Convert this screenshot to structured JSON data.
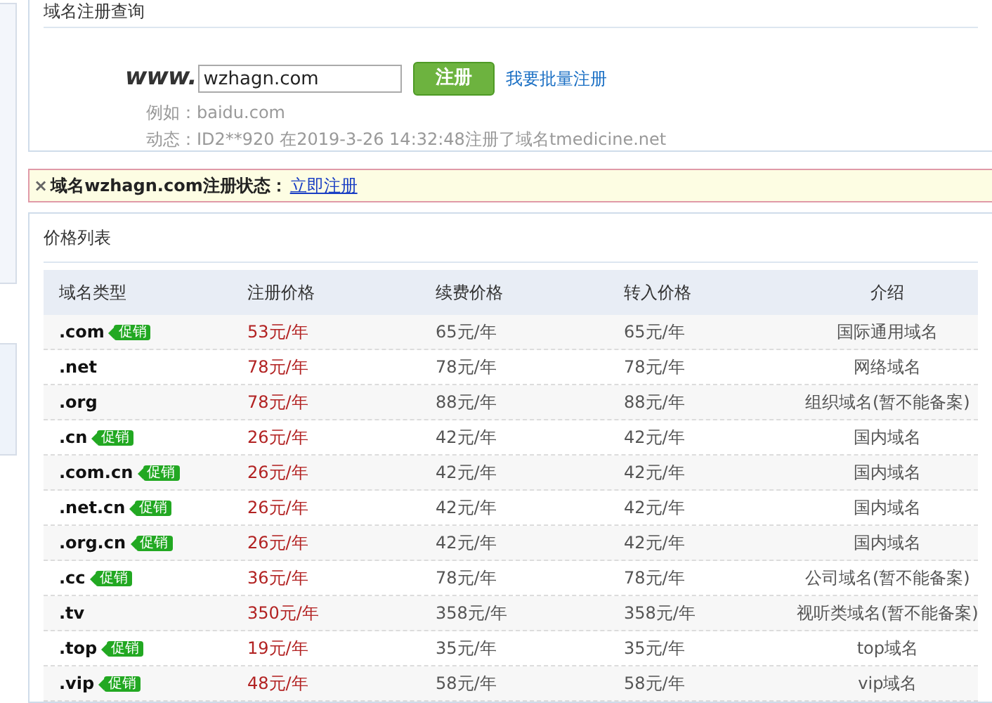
{
  "query_panel": {
    "title": "域名注册查询",
    "prefix": "www.",
    "domain_value": "wzhagn.com",
    "register_button": "注册",
    "bulk_link": "我要批量注册",
    "example": "例如：baidu.com",
    "activity": "动态：ID2**920 在2019-3-26 14:32:48注册了域名tmedicine.net"
  },
  "status_bar": {
    "close": "×",
    "message": "域名wzhagn.com注册状态：",
    "link": "立即注册"
  },
  "price_panel": {
    "title": "价格列表",
    "columns": [
      "域名类型",
      "注册价格",
      "续费价格",
      "转入价格",
      "介绍"
    ],
    "rows": [
      {
        "tld": ".com",
        "promo": true,
        "badge": "促销",
        "register": "53元/年",
        "renew": "65元/年",
        "transfer": "65元/年",
        "intro": "国际通用域名"
      },
      {
        "tld": ".net",
        "promo": false,
        "register": "78元/年",
        "renew": "78元/年",
        "transfer": "78元/年",
        "intro": "网络域名"
      },
      {
        "tld": ".org",
        "promo": false,
        "register": "78元/年",
        "renew": "88元/年",
        "transfer": "88元/年",
        "intro": "组织域名(暂不能备案)"
      },
      {
        "tld": ".cn",
        "promo": true,
        "badge": "促销",
        "register": "26元/年",
        "renew": "42元/年",
        "transfer": "42元/年",
        "intro": "国内域名"
      },
      {
        "tld": ".com.cn",
        "promo": true,
        "badge": "促销",
        "register": "26元/年",
        "renew": "42元/年",
        "transfer": "42元/年",
        "intro": "国内域名"
      },
      {
        "tld": ".net.cn",
        "promo": true,
        "badge": "促销",
        "register": "26元/年",
        "renew": "42元/年",
        "transfer": "42元/年",
        "intro": "国内域名"
      },
      {
        "tld": ".org.cn",
        "promo": true,
        "badge": "促销",
        "register": "26元/年",
        "renew": "42元/年",
        "transfer": "42元/年",
        "intro": "国内域名"
      },
      {
        "tld": ".cc",
        "promo": true,
        "badge": "促销",
        "register": "36元/年",
        "renew": "78元/年",
        "transfer": "78元/年",
        "intro": "公司域名(暂不能备案)"
      },
      {
        "tld": ".tv",
        "promo": false,
        "register": "350元/年",
        "renew": "358元/年",
        "transfer": "358元/年",
        "intro": "视听类域名(暂不能备案)"
      },
      {
        "tld": ".top",
        "promo": true,
        "badge": "促销",
        "register": "19元/年",
        "renew": "35元/年",
        "transfer": "35元/年",
        "intro": "top域名"
      },
      {
        "tld": ".vip",
        "promo": true,
        "badge": "促销",
        "register": "48元/年",
        "renew": "58元/年",
        "transfer": "58元/年",
        "intro": "vip域名"
      }
    ]
  }
}
